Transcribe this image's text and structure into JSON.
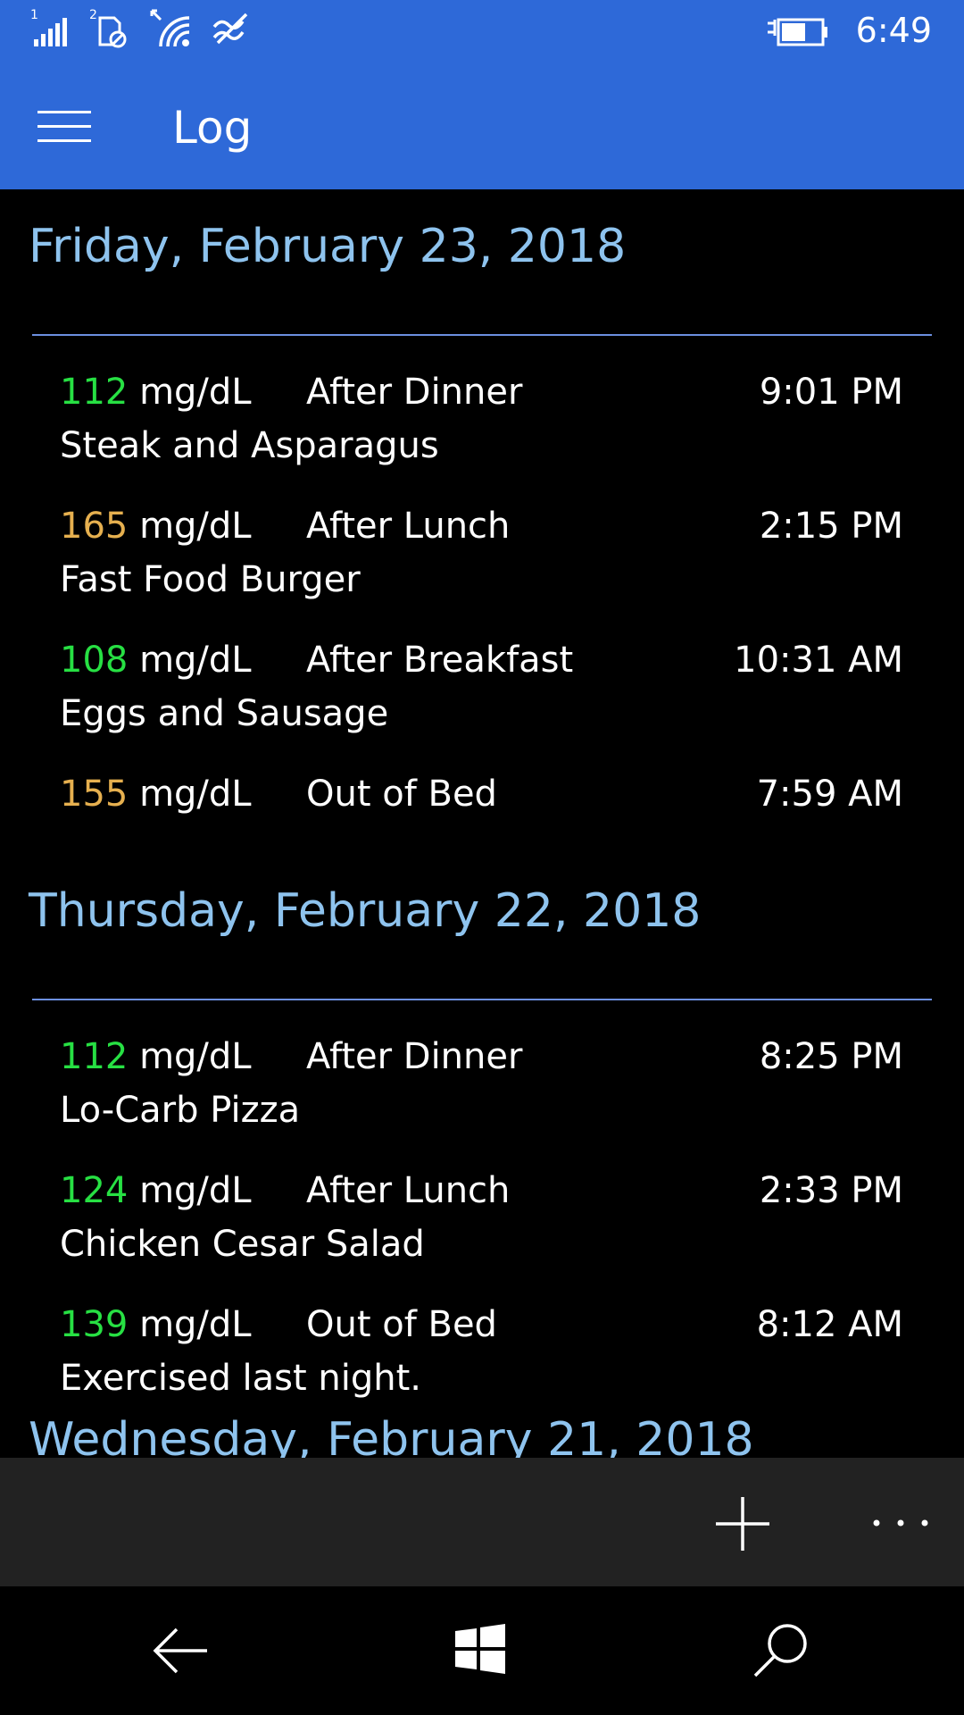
{
  "status_bar": {
    "time": "6:49",
    "sim1_label": "1",
    "sim2_label": "2",
    "icons": [
      "signal-bars-icon",
      "sim2-no-service-icon",
      "wifi-icon",
      "data-sense-icon",
      "battery-charging-icon"
    ]
  },
  "header": {
    "title": "Log",
    "menu_icon": "hamburger-menu-icon"
  },
  "colors": {
    "accent": "#2e69d8",
    "day_header": "#8ec3ee",
    "divider": "#6c8fe0",
    "in_range": "#27e043",
    "elevated": "#e6b04f",
    "app_bar": "#222222"
  },
  "days": [
    {
      "date": "Friday, February 23, 2018",
      "entries": [
        {
          "value": "112",
          "unit": "mg/dL",
          "label": "After Dinner",
          "time": "9:01 PM",
          "note": "Steak and Asparagus",
          "status": "in-range"
        },
        {
          "value": "165",
          "unit": "mg/dL",
          "label": "After Lunch",
          "time": "2:15 PM",
          "note": "Fast Food Burger",
          "status": "elevated"
        },
        {
          "value": "108",
          "unit": "mg/dL",
          "label": "After Breakfast",
          "time": "10:31 AM",
          "note": "Eggs and Sausage",
          "status": "in-range"
        },
        {
          "value": "155",
          "unit": "mg/dL",
          "label": "Out of Bed",
          "time": "7:59 AM",
          "note": "",
          "status": "elevated"
        }
      ]
    },
    {
      "date": "Thursday, February 22, 2018",
      "entries": [
        {
          "value": "112",
          "unit": "mg/dL",
          "label": "After Dinner",
          "time": "8:25 PM",
          "note": "Lo-Carb Pizza",
          "status": "in-range"
        },
        {
          "value": "124",
          "unit": "mg/dL",
          "label": "After Lunch",
          "time": "2:33 PM",
          "note": "Chicken Cesar Salad",
          "status": "in-range"
        },
        {
          "value": "139",
          "unit": "mg/dL",
          "label": "Out of Bed",
          "time": "8:12 AM",
          "note": "Exercised last night.",
          "status": "in-range"
        }
      ]
    },
    {
      "date": "Wednesday, February 21, 2018",
      "entries": []
    }
  ],
  "app_bar": {
    "add_icon": "plus-icon",
    "more_icon": "ellipsis-icon"
  },
  "nav_bar": {
    "icons": [
      "back-arrow-icon",
      "windows-start-icon",
      "search-icon"
    ]
  }
}
